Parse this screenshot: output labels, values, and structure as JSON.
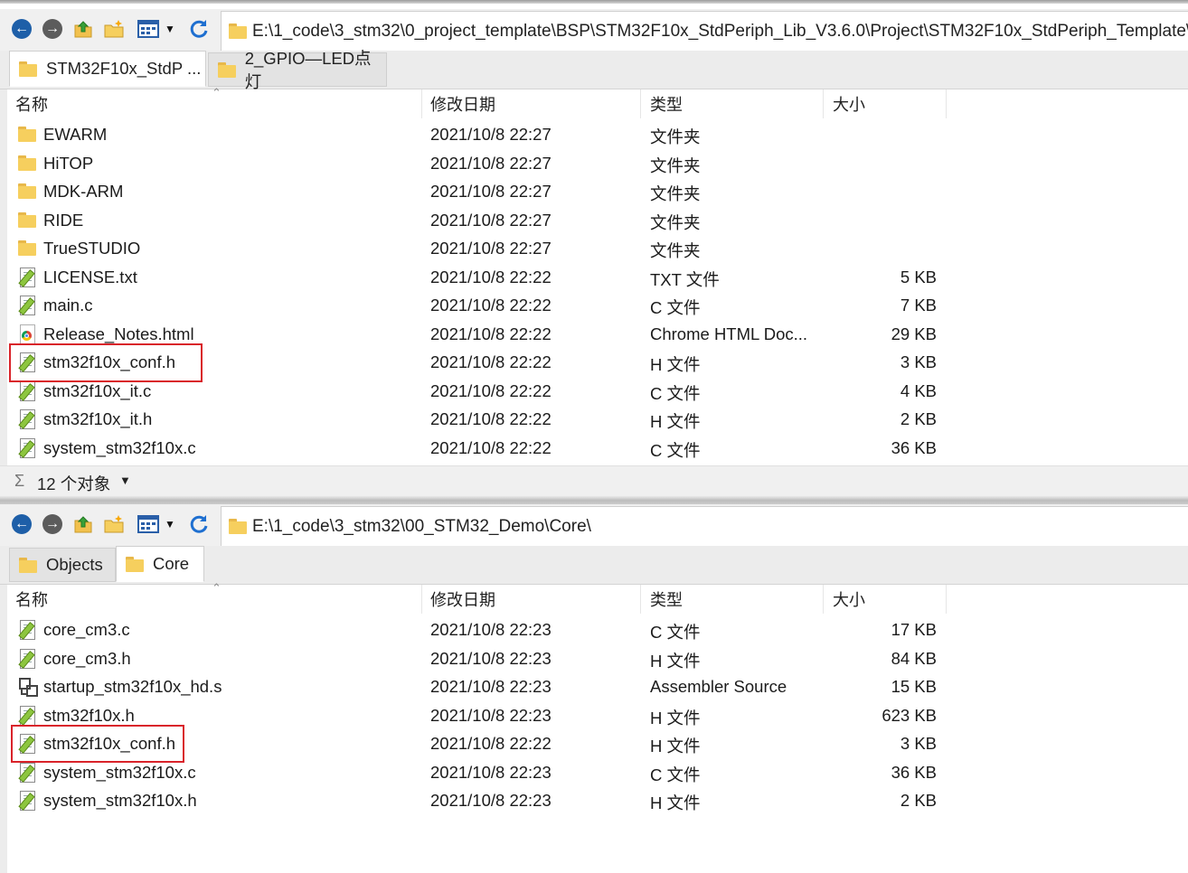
{
  "pane1": {
    "toolbar": {
      "back_icon": "back-arrow-icon",
      "forward_icon": "forward-arrow-icon",
      "up_icon": "folder-up-icon",
      "new_folder_icon": "new-folder-icon",
      "view_icon": "view-mode-icon",
      "refresh_icon": "refresh-icon"
    },
    "address": "E:\\1_code\\3_stm32\\0_project_template\\BSP\\STM32F10x_StdPeriph_Lib_V3.6.0\\Project\\STM32F10x_StdPeriph_Template\\",
    "tabs": [
      {
        "label": "STM32F10x_StdP ...",
        "active": true
      },
      {
        "label": "2_GPIO—LED点灯",
        "active": false
      }
    ],
    "columns": {
      "name": "名称",
      "date": "修改日期",
      "type": "类型",
      "size": "大小"
    },
    "files": [
      {
        "name": "EWARM",
        "date": "2021/10/8 22:27",
        "type": "文件夹",
        "size": "",
        "icon": "folder"
      },
      {
        "name": "HiTOP",
        "date": "2021/10/8 22:27",
        "type": "文件夹",
        "size": "",
        "icon": "folder"
      },
      {
        "name": "MDK-ARM",
        "date": "2021/10/8 22:27",
        "type": "文件夹",
        "size": "",
        "icon": "folder"
      },
      {
        "name": "RIDE",
        "date": "2021/10/8 22:27",
        "type": "文件夹",
        "size": "",
        "icon": "folder"
      },
      {
        "name": "TrueSTUDIO",
        "date": "2021/10/8 22:27",
        "type": "文件夹",
        "size": "",
        "icon": "folder"
      },
      {
        "name": "LICENSE.txt",
        "date": "2021/10/8 22:22",
        "type": "TXT 文件",
        "size": "5 KB",
        "icon": "file"
      },
      {
        "name": "main.c",
        "date": "2021/10/8 22:22",
        "type": "C 文件",
        "size": "7 KB",
        "icon": "file"
      },
      {
        "name": "Release_Notes.html",
        "date": "2021/10/8 22:22",
        "type": "Chrome HTML Doc...",
        "size": "29 KB",
        "icon": "html"
      },
      {
        "name": "stm32f10x_conf.h",
        "date": "2021/10/8 22:22",
        "type": "H 文件",
        "size": "3 KB",
        "icon": "file"
      },
      {
        "name": "stm32f10x_it.c",
        "date": "2021/10/8 22:22",
        "type": "C 文件",
        "size": "4 KB",
        "icon": "file"
      },
      {
        "name": "stm32f10x_it.h",
        "date": "2021/10/8 22:22",
        "type": "H 文件",
        "size": "2 KB",
        "icon": "file"
      },
      {
        "name": "system_stm32f10x.c",
        "date": "2021/10/8 22:22",
        "type": "C 文件",
        "size": "36 KB",
        "icon": "file"
      }
    ],
    "status": {
      "sigma": "Σ",
      "count": "12 个对象"
    }
  },
  "pane2": {
    "toolbar": {
      "back_icon": "back-arrow-icon",
      "forward_icon": "forward-arrow-icon",
      "up_icon": "folder-up-icon",
      "new_folder_icon": "new-folder-icon",
      "view_icon": "view-mode-icon",
      "refresh_icon": "refresh-icon"
    },
    "address": "E:\\1_code\\3_stm32\\00_STM32_Demo\\Core\\",
    "tabs": [
      {
        "label": "Objects",
        "active": false
      },
      {
        "label": "Core",
        "active": true
      }
    ],
    "columns": {
      "name": "名称",
      "date": "修改日期",
      "type": "类型",
      "size": "大小"
    },
    "files": [
      {
        "name": "core_cm3.c",
        "date": "2021/10/8 22:23",
        "type": "C 文件",
        "size": "17 KB",
        "icon": "file"
      },
      {
        "name": "core_cm3.h",
        "date": "2021/10/8 22:23",
        "type": "H 文件",
        "size": "84 KB",
        "icon": "file"
      },
      {
        "name": "startup_stm32f10x_hd.s",
        "date": "2021/10/8 22:23",
        "type": "Assembler Source",
        "size": "15 KB",
        "icon": "asm"
      },
      {
        "name": "stm32f10x.h",
        "date": "2021/10/8 22:23",
        "type": "H 文件",
        "size": "623 KB",
        "icon": "file"
      },
      {
        "name": "stm32f10x_conf.h",
        "date": "2021/10/8 22:22",
        "type": "H 文件",
        "size": "3 KB",
        "icon": "file"
      },
      {
        "name": "system_stm32f10x.c",
        "date": "2021/10/8 22:23",
        "type": "C 文件",
        "size": "36 KB",
        "icon": "file"
      },
      {
        "name": "system_stm32f10x.h",
        "date": "2021/10/8 22:23",
        "type": "H 文件",
        "size": "2 KB",
        "icon": "file"
      }
    ]
  },
  "colors": {
    "highlight": "#d9232a",
    "folder": "#f6cf5e",
    "nav_blue": "#1e5fa8"
  }
}
